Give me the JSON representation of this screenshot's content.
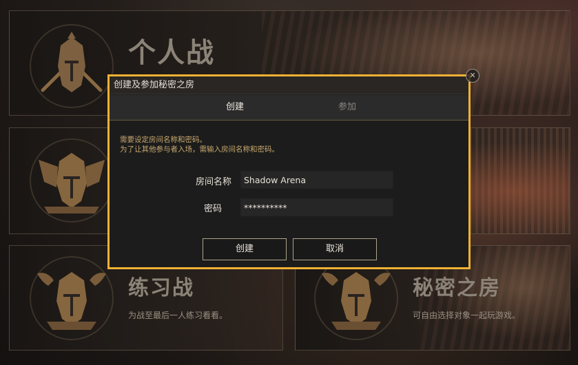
{
  "cards": {
    "individual": {
      "title": "个人战",
      "icon": "knight-helmet-crossed-swords-emblem"
    },
    "second": {
      "icon": "knight-helmet-flags-emblem"
    },
    "practice": {
      "title": "练习战",
      "desc": "为战至最后一人练习看看。",
      "icon": "knight-helmet-crossed-axes-emblem"
    },
    "secret": {
      "title": "秘密之房",
      "desc": "可自由选择对象一起玩游戏。",
      "icon": "knight-helmet-crossed-axes-emblem"
    }
  },
  "dialog": {
    "title": "创建及参加秘密之房",
    "close_icon": "close-icon",
    "tabs": [
      {
        "label": "创建",
        "active": true
      },
      {
        "label": "参加",
        "active": false
      }
    ],
    "note_line1": "需要设定房间名称和密码。",
    "note_line2": "为了让其他参与者入场，需输入房间名称和密码。",
    "room_name_label": "房间名称",
    "room_name_value": "Shadow Arena",
    "password_label": "密码",
    "password_value": "**********",
    "create_button": "创建",
    "cancel_button": "取消"
  },
  "colors": {
    "accent_border": "#f2b234",
    "note_text": "#c9a96e"
  }
}
